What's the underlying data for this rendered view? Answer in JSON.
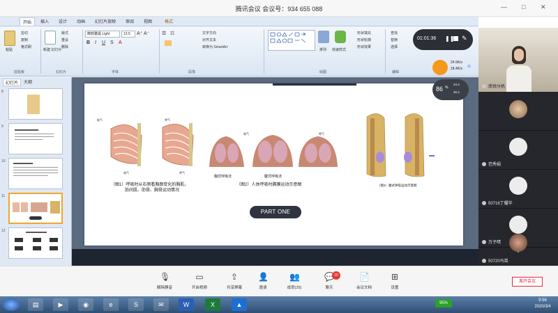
{
  "meeting": {
    "title": "腾讯会议  会议号：934 655 088",
    "window_controls": [
      "—",
      "□",
      "✕"
    ],
    "record_time": "01:01:36",
    "net_up": "24.9K/s",
    "net_down": "18.4K/s",
    "cpu_percent": "86",
    "cpu_suffix": "%",
    "cpu_up": "24.4",
    "cpu_down": "26.4"
  },
  "ppt": {
    "tabs": [
      "开始",
      "插入",
      "设计",
      "动画",
      "幻灯片放映",
      "审阅",
      "视图",
      "格式"
    ],
    "ribbon": {
      "paste": "粘贴",
      "cut": "剪切",
      "copy": "复制",
      "format_painter": "格式刷",
      "new_slide": "新建\n幻灯片",
      "layout": "版式",
      "reset": "重设",
      "delete": "删除",
      "font_name": "微软雅黑 Light",
      "font_size": "13.5",
      "text_direction": "文字方向",
      "align_text": "对齐文本",
      "smartart": "转换为 SmartArt",
      "arrange": "排列",
      "quick_styles": "快速样式",
      "shape_fill": "形状填充",
      "shape_outline": "形状轮廓",
      "shape_effects": "形状效果",
      "find": "查找",
      "replace": "替换",
      "select": "选择",
      "groups": [
        "剪贴板",
        "幻灯片",
        "字体",
        "段落",
        "绘图",
        "编辑"
      ]
    },
    "panel_tabs": [
      "幻灯片",
      "大纲"
    ],
    "thumb_numbers": [
      "8",
      "9",
      "10",
      "11",
      "12"
    ],
    "slide": {
      "captions": {
        "fig1_line1": "（图1）呼吸时从右侧看胸廓变化的胸肌，",
        "fig1_line2": "肋间肌、肋骨、胸骨运动情况",
        "fig2": "（图2）人体呼吸时膈膜运动示意图",
        "fig3": "（图3）腹式呼吸运动示意图",
        "chest_breath": "胸式呼吸法",
        "abd_breath": "腹式呼吸法",
        "inhale": "吸气",
        "exhale": "呼气",
        "inhale2": "吸气",
        "exhale2": "呼气",
        "inhale_top": "吸气",
        "exhale_top": "呼气"
      },
      "part_label": "PART ONE"
    }
  },
  "participants": [
    {
      "name": "南锐分机"
    },
    {
      "name": ""
    },
    {
      "name": "范秀娟"
    },
    {
      "name": "50716丁耀华"
    },
    {
      "name": "万子晴"
    },
    {
      "name": "50720马苗"
    }
  ],
  "toolbar": {
    "items": [
      "解除静音",
      "开启视频",
      "共享屏幕",
      "邀请",
      "成员(25)",
      "聊天",
      "会议文档",
      "设置"
    ],
    "chat_badge": "20",
    "leave": "离开会议"
  },
  "taskbar": {
    "battery": "95%",
    "time": "9:56",
    "date": "2020/3/4"
  }
}
